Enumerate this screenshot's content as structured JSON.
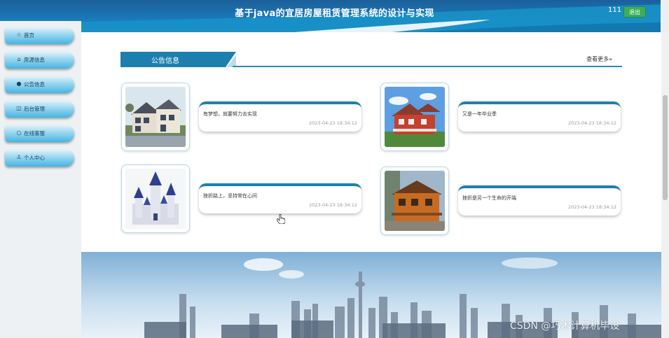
{
  "header": {
    "title": "基于java的宜居房屋租赁管理系统的设计与实现",
    "user": "111",
    "logout_label": "退出"
  },
  "sidebar": {
    "items": [
      {
        "label": "首页",
        "icon": "star-icon"
      },
      {
        "label": "房源信息",
        "icon": "house-icon"
      },
      {
        "label": "公告信息",
        "icon": "bell-icon"
      },
      {
        "label": "后台管理",
        "icon": "admin-icon"
      },
      {
        "label": "在线客服",
        "icon": "chat-icon"
      },
      {
        "label": "个人中心",
        "icon": "user-icon"
      }
    ]
  },
  "notice": {
    "section_title": "公告信息",
    "more_label": "查看更多»",
    "items": [
      {
        "text": "有梦想，就要努力去实现",
        "date": "2023-04-23 18:34:12",
        "image": "villa-photo"
      },
      {
        "text": "又是一年毕业季",
        "date": "2023-04-23 18:34:12",
        "image": "red-house-photo"
      },
      {
        "text": "挫折路上，坚持常在心间",
        "date": "2023-04-23 18:34:12",
        "image": "castle-photo"
      },
      {
        "text": "挫折是另一个生命的开端",
        "date": "2023-04-23 18:34:12",
        "image": "wooden-house-photo"
      }
    ]
  },
  "watermark": "CSDN @巧木计算机毕设",
  "colors": {
    "header_blue": "#1a78b6",
    "accent_blue": "#1e7fae",
    "logout_green": "#3cae5a"
  }
}
